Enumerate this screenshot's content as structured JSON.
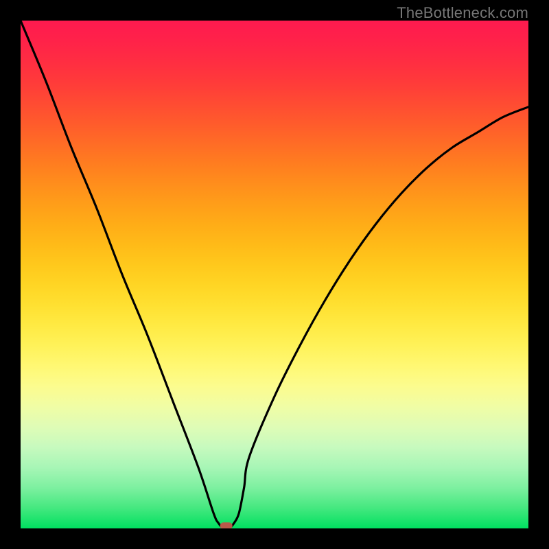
{
  "watermark": "TheBottleneck.com",
  "chart_data": {
    "type": "line",
    "title": "",
    "xlabel": "",
    "ylabel": "",
    "xlim": [
      0,
      100
    ],
    "ylim": [
      0,
      100
    ],
    "x_comment": "x is resolution/load index (0–100), y is bottleneck percentage (0–100)",
    "curve_x": [
      0,
      5,
      10,
      15,
      20,
      25,
      30,
      35,
      38,
      39,
      40,
      41,
      42,
      43,
      44,
      45,
      50,
      55,
      60,
      65,
      70,
      75,
      80,
      85,
      90,
      95,
      100
    ],
    "curve_y": [
      100,
      88,
      75,
      63,
      50,
      38,
      25,
      12,
      3,
      1,
      0,
      0,
      1,
      3,
      8,
      14,
      26,
      36,
      45,
      53,
      60,
      66,
      71,
      75,
      78,
      81,
      83
    ],
    "dip_marker": {
      "x": 40.5,
      "y": 0.5
    },
    "background_bands_comment": "vertical gradient bands, sampled at 2% steps from top (y=100) to bottom (y=0)",
    "background_bands": [
      {
        "y": 100,
        "color": "#ff1a4f"
      },
      {
        "y": 96,
        "color": "#ff2249"
      },
      {
        "y": 92,
        "color": "#ff2d42"
      },
      {
        "y": 88,
        "color": "#ff3a3a"
      },
      {
        "y": 84,
        "color": "#ff4a33"
      },
      {
        "y": 80,
        "color": "#ff5a2c"
      },
      {
        "y": 76,
        "color": "#ff6b26"
      },
      {
        "y": 72,
        "color": "#ff7c20"
      },
      {
        "y": 68,
        "color": "#ff8d1c"
      },
      {
        "y": 64,
        "color": "#ff9d19"
      },
      {
        "y": 60,
        "color": "#ffac17"
      },
      {
        "y": 56,
        "color": "#ffba18"
      },
      {
        "y": 52,
        "color": "#ffc81c"
      },
      {
        "y": 48,
        "color": "#ffd524"
      },
      {
        "y": 44,
        "color": "#ffe031"
      },
      {
        "y": 40,
        "color": "#ffea43"
      },
      {
        "y": 36,
        "color": "#fff259"
      },
      {
        "y": 32,
        "color": "#fff873"
      },
      {
        "y": 28,
        "color": "#fcfc8e"
      },
      {
        "y": 24,
        "color": "#f0fda5"
      },
      {
        "y": 20,
        "color": "#dffcb6"
      },
      {
        "y": 16,
        "color": "#c7fabe"
      },
      {
        "y": 12,
        "color": "#a7f6b6"
      },
      {
        "y": 8,
        "color": "#7df0a0"
      },
      {
        "y": 4,
        "color": "#44e87f"
      },
      {
        "y": 0,
        "color": "#00e060"
      }
    ]
  }
}
